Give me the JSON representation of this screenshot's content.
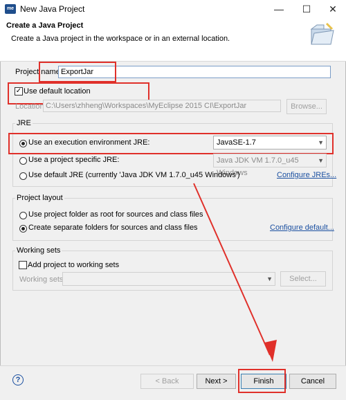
{
  "window": {
    "title": "New Java Project",
    "app_icon": "me",
    "minimize": "—",
    "maximize": "☐",
    "close": "✕"
  },
  "banner": {
    "title": "Create a Java Project",
    "description": "Create a Java project in the workspace or in an external location."
  },
  "project": {
    "label": "Project name:",
    "value": "ExportJar"
  },
  "location": {
    "use_default_label": "Use default location",
    "label": "Location:",
    "value": "C:\\Users\\zhheng\\Workspaces\\MyEclipse 2015 CI\\ExportJar",
    "browse": "Browse..."
  },
  "jre": {
    "title": "JRE",
    "option_env": "Use an execution environment JRE:",
    "env_value": "JavaSE-1.7",
    "option_specific": "Use a project specific JRE:",
    "specific_value": "Java JDK VM 1.7.0_u45 Windows",
    "option_default": "Use default JRE (currently 'Java JDK VM 1.7.0_u45 Windows')",
    "configure_link": "Configure JREs..."
  },
  "layout": {
    "title": "Project layout",
    "option_root": "Use project folder as root for sources and class files",
    "option_separate": "Create separate folders for sources and class files",
    "configure_link": "Configure default..."
  },
  "working_sets": {
    "title": "Working sets",
    "add_label": "Add project to working sets",
    "label": "Working sets:",
    "select": "Select..."
  },
  "footer": {
    "help": "?",
    "back": "< Back",
    "next": "Next >",
    "finish": "Finish",
    "cancel": "Cancel"
  },
  "colors": {
    "annotation": "#e0302a",
    "link": "#1a4fa0"
  }
}
